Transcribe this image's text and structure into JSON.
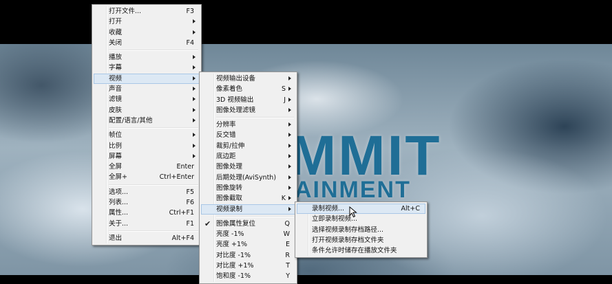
{
  "video": {
    "logo_main": "MMIT",
    "logo_sub": "AINMENT"
  },
  "main_menu": {
    "groups": [
      [
        {
          "label": "打开文件...",
          "shortcut": "F3"
        },
        {
          "label": "打开",
          "submenu": true
        },
        {
          "label": "收藏",
          "submenu": true
        },
        {
          "label": "关闭",
          "shortcut": "F4"
        }
      ],
      [
        {
          "label": "播放",
          "submenu": true
        },
        {
          "label": "字幕",
          "submenu": true
        },
        {
          "label": "视频",
          "submenu": true,
          "selected": true
        },
        {
          "label": "声音",
          "submenu": true
        },
        {
          "label": "滤镜",
          "submenu": true
        },
        {
          "label": "皮肤",
          "submenu": true
        },
        {
          "label": "配置/语言/其他",
          "submenu": true
        }
      ],
      [
        {
          "label": "帧位",
          "submenu": true
        },
        {
          "label": "比例",
          "submenu": true
        },
        {
          "label": "屏幕",
          "submenu": true
        },
        {
          "label": "全屏",
          "shortcut": "Enter"
        },
        {
          "label": "全屏+",
          "shortcut": "Ctrl+Enter"
        }
      ],
      [
        {
          "label": "选项...",
          "shortcut": "F5"
        },
        {
          "label": "列表...",
          "shortcut": "F6"
        },
        {
          "label": "属性...",
          "shortcut": "Ctrl+F1"
        },
        {
          "label": "关于...",
          "shortcut": "F1"
        }
      ],
      [
        {
          "label": "退出",
          "shortcut": "Alt+F4"
        }
      ]
    ]
  },
  "video_menu": {
    "groups": [
      [
        {
          "label": "视频输出设备",
          "submenu": true
        },
        {
          "label": "像素着色",
          "shortcut": "S",
          "submenu": true
        },
        {
          "label": "3D 视频输出",
          "shortcut": "J",
          "submenu": true
        },
        {
          "label": "图像处理滤镜",
          "submenu": true
        }
      ],
      [
        {
          "label": "分辨率",
          "submenu": true
        },
        {
          "label": "反交错",
          "submenu": true
        },
        {
          "label": "裁剪/拉伸",
          "submenu": true
        },
        {
          "label": "底边距",
          "submenu": true
        },
        {
          "label": "图像处理",
          "submenu": true
        },
        {
          "label": "后期处理(AviSynth)",
          "submenu": true
        },
        {
          "label": "图像旋转",
          "submenu": true
        },
        {
          "label": "图像截取",
          "shortcut": "K",
          "submenu": true
        },
        {
          "label": "视频录制",
          "submenu": true,
          "selected": true
        }
      ],
      [
        {
          "label": "图像属性复位",
          "shortcut": "Q",
          "checked": true
        },
        {
          "label": "亮度 -1%",
          "shortcut": "W"
        },
        {
          "label": "亮度 +1%",
          "shortcut": "E"
        },
        {
          "label": "对比度 -1%",
          "shortcut": "R"
        },
        {
          "label": "对比度 +1%",
          "shortcut": "T"
        },
        {
          "label": "饱和度 -1%",
          "shortcut": "Y"
        }
      ]
    ]
  },
  "record_menu": {
    "items": [
      {
        "label": "录制视频...",
        "shortcut": "Alt+C",
        "selected": true
      },
      {
        "label": "立即录制视频..."
      },
      {
        "label": "选择视频录制存档路径..."
      },
      {
        "label": "打开视频录制存档文件夹"
      },
      {
        "label": "条件允许时储存在播放文件夹"
      }
    ]
  }
}
